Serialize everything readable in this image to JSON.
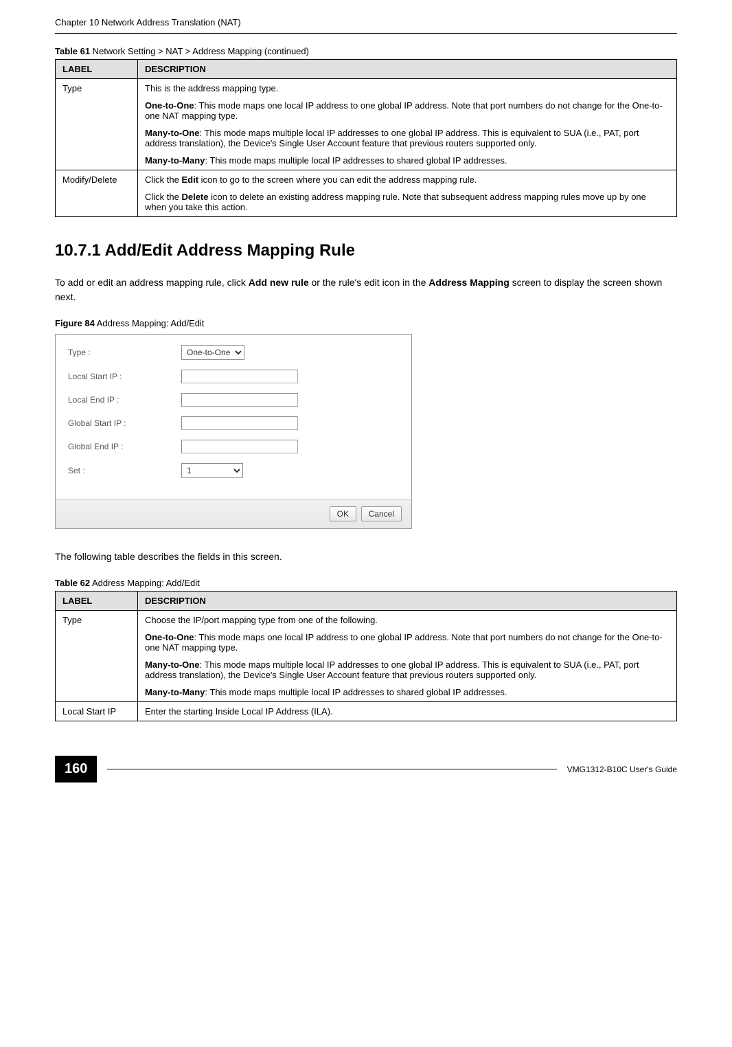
{
  "header": {
    "chapter_title": "Chapter 10 Network Address Translation (NAT)"
  },
  "table61": {
    "caption_bold": "Table 61",
    "caption_rest": "   Network Setting > NAT > Address Mapping (continued)",
    "header_label": "LABEL",
    "header_desc": "DESCRIPTION",
    "rows": [
      {
        "label": "Type",
        "paragraphs": [
          "This is the address mapping type.",
          "<b>One-to-One</b>: This mode maps one local IP address to one global IP address. Note that port numbers do not change for the One-to-one NAT mapping type.",
          "<b>Many-to-One</b>: This mode maps multiple local IP addresses to one global IP address. This is equivalent to SUA (i.e., PAT, port address translation), the Device's Single User Account feature that previous routers supported only.",
          "<b>Many-to-Many</b>: This mode maps multiple local IP addresses to shared global IP addresses."
        ]
      },
      {
        "label": "Modify/Delete",
        "paragraphs": [
          "Click the <b>Edit</b> icon to go to the screen where you can edit the address mapping rule.",
          "Click the <b>Delete</b> icon to delete an existing address mapping rule. Note that subsequent address mapping rules move up by one when you take this action."
        ]
      }
    ]
  },
  "section": {
    "heading": "10.7.1  Add/Edit Address Mapping Rule",
    "intro_html": "To add or edit an address mapping rule, click <b>Add new rule</b> or the rule's edit icon in the <b>Address Mapping</b> screen to display the screen shown next."
  },
  "figure84": {
    "caption_bold": "Figure 84",
    "caption_rest": "   Address Mapping: Add/Edit",
    "fields": {
      "type_label": "Type :",
      "type_value": "One-to-One",
      "local_start_label": "Local Start IP :",
      "local_end_label": "Local End IP :",
      "global_start_label": "Global Start IP :",
      "global_end_label": "Global End IP :",
      "set_label": "Set :",
      "set_value": "1"
    },
    "buttons": {
      "ok": "OK",
      "cancel": "Cancel"
    }
  },
  "table62_intro": "The following table describes the fields in this screen.",
  "table62": {
    "caption_bold": "Table 62",
    "caption_rest": "   Address Mapping: Add/Edit",
    "header_label": "LABEL",
    "header_desc": "DESCRIPTION",
    "rows": [
      {
        "label": "Type",
        "paragraphs": [
          "Choose the IP/port mapping type from one of the following.",
          "<b>One-to-One</b>: This mode maps one local IP address to one global IP address. Note that port numbers do not change for the One-to-one NAT mapping type.",
          "<b>Many-to-One</b>: This mode maps multiple local IP addresses to one global IP address. This is equivalent to SUA (i.e., PAT, port address translation), the Device's Single User Account feature that previous routers supported only.",
          "<b>Many-to-Many</b>: This mode maps multiple local IP addresses to shared global IP addresses."
        ]
      },
      {
        "label": "Local Start IP",
        "paragraphs": [
          "Enter the starting Inside Local IP Address (ILA)."
        ]
      }
    ]
  },
  "footer": {
    "page_number": "160",
    "guide_name": "VMG1312-B10C User's Guide"
  }
}
